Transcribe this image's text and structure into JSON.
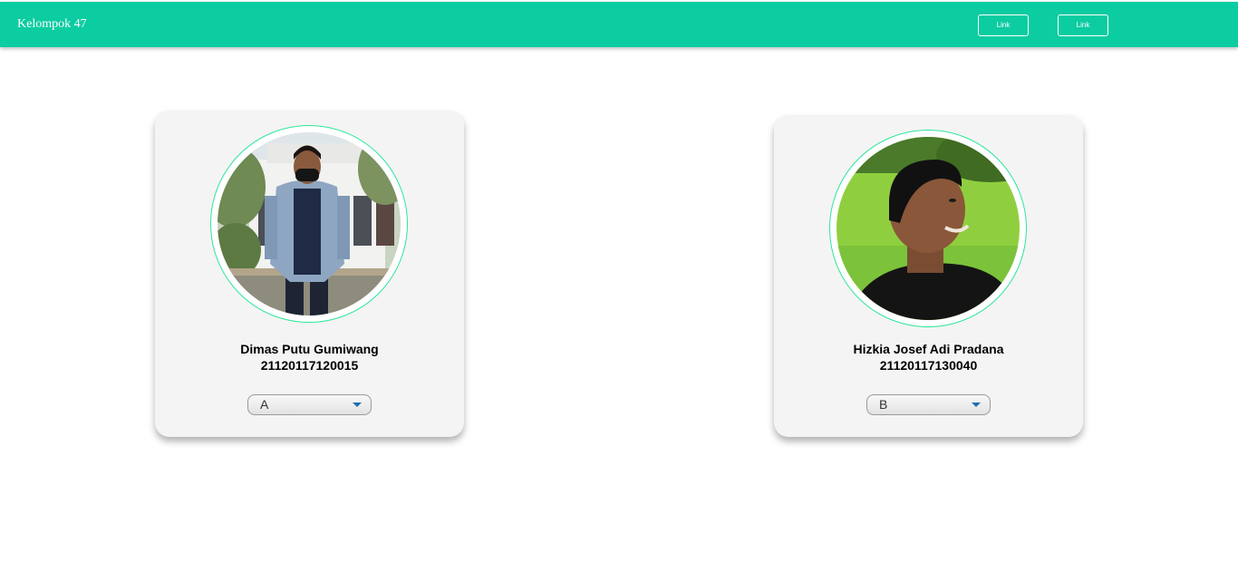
{
  "navbar": {
    "brand": "Kelompok 47",
    "links": [
      "Link",
      "Link"
    ],
    "color": "#0ccca1"
  },
  "members": [
    {
      "name": "Dimas Putu Gumiwang",
      "id": "21120117120015",
      "selected": "A",
      "photo": "person-in-mask-denim-jacket"
    },
    {
      "name": "Hizkia Josef Adi Pradana",
      "id": "21120117130040",
      "selected": "B",
      "photo": "smiling-person-on-grass"
    }
  ],
  "colors": {
    "ring": "#2ee69a",
    "card": "#f4f4f4",
    "caret": "#1e6fb4"
  }
}
